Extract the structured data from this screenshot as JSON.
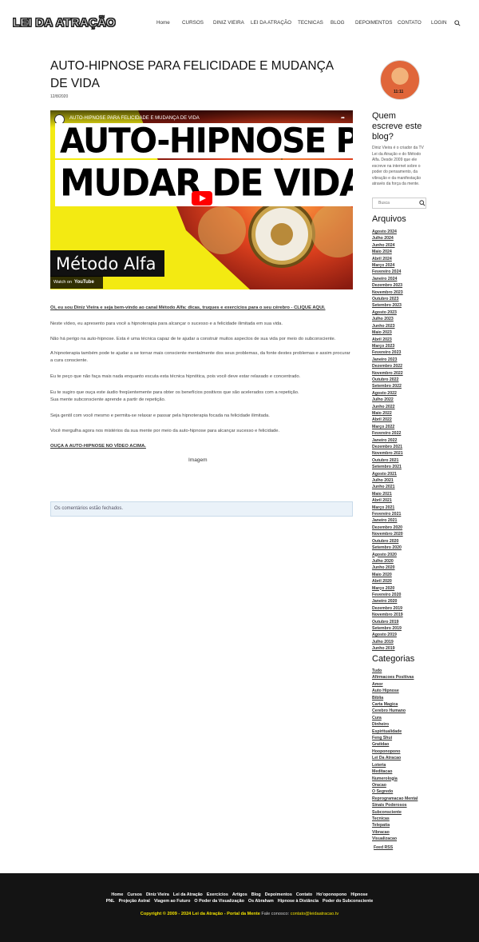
{
  "header": {
    "logo": "LEI DA ATRAÇÃO",
    "nav": [
      "Home",
      "CURSOS",
      "DINIZ VIEIRA",
      "LEI DA ATRAÇÃO",
      "TECNICAS",
      "BLOG",
      "DEPOIMENTOS",
      "CONTATO",
      "LOGIN"
    ]
  },
  "post": {
    "title": "AUTO-HIPNOSE PARA FELICIDADE E MUDANÇA DE VIDA",
    "date": "12/8/2020",
    "video": {
      "channel_title": "AUTO-HIPNOSE PARA FELICIDADE E MUDANÇA DE VIDA",
      "share": "Share",
      "thumb_line1": "AUTO-HIPNOSE PARA",
      "thumb_line2": "MUDAR DE VIDA",
      "brand": "Método Alfa",
      "watch_on": "Watch on",
      "youtube": "YouTube"
    },
    "paragraphs": [
      "Oi, eu sou Diniz Vieira e seja bem-vindo ao canal Método Alfa: dicas, truques e exercícios para o seu cérebro - CLIQUE AQUI.",
      "Neste vídeo, eu apresento para você a hipnoterapia para alcançar o sucesso e a felicidade ilimitada em sua vida.",
      "Não há perigo na auto-hipnose. Esta é uma técnica capaz de te ajudar a construir muitos aspectos de sua vida por meio do subconsciente.",
      "A hipnoterapia também pode te ajudar a se tornar mais consciente mentalmente dos seus problemas, da fonte destes problemas e assim procurar a cura consciente.",
      "Eu te peço que não faça mais nada enquanto escuta esta técnica hipnótica, pois você deve estar relaxado e concentrado.",
      "Eu te sugiro que ouça este áudio freqüentemente para obter os benefícios positivos que são acelerados com a repetição.",
      "Sua mente subconsciente aprende a partir de repetição.",
      "Seja gentil com você mesmo e permita-se relaxar e passar pela hipnoterapia focada na felicidade ilimitada.",
      "Você mergulha agora nos mistérios da sua mente por meio da auto-hipnose para alcançar sucesso e felicidade.",
      "OUÇA A AUTO-HIPNOSE NO VÍDEO ACIMA."
    ],
    "image_alt": "Imagem",
    "comments_closed": "Os comentários estão fechados."
  },
  "sidebar": {
    "about_heading": "Quem escreve este blog?",
    "about_text": "Diniz Vieira é o criador da TV Lei da Atração e do Método Alfa. Desde 2009 que ele escreve na internet sobre o poder do pensamento, da vibração e da manifestação através da força da mente.",
    "search_placeholder": "Busca",
    "archives_heading": "Arquivos",
    "archives": [
      "Agosto 2024",
      "Julho 2024",
      "Junho 2024",
      "Maio 2024",
      "Abril 2024",
      "Março 2024",
      "Fevereiro 2024",
      "Janeiro 2024",
      "Dezembro 2023",
      "Novembro 2023",
      "Outubro 2023",
      "Setembro 2023",
      "Agosto 2023",
      "Julho 2023",
      "Junho 2023",
      "Maio 2023",
      "Abril 2023",
      "Março 2023",
      "Fevereiro 2023",
      "Janeiro 2023",
      "Dezembro 2022",
      "Novembro 2022",
      "Outubro 2022",
      "Setembro 2022",
      "Agosto 2022",
      "Julho 2022",
      "Junho 2022",
      "Maio 2022",
      "Abril 2022",
      "Março 2022",
      "Fevereiro 2022",
      "Janeiro 2022",
      "Dezembro 2021",
      "Novembro 2021",
      "Outubro 2021",
      "Setembro 2021",
      "Agosto 2021",
      "Julho 2021",
      "Junho 2021",
      "Maio 2021",
      "Abril 2021",
      "Março 2021",
      "Fevereiro 2021",
      "Janeiro 2021",
      "Dezembro 2020",
      "Novembro 2020",
      "Outubro 2020",
      "Setembro 2020",
      "Agosto 2020",
      "Julho 2020",
      "Junho 2020",
      "Maio 2020",
      "Abril 2020",
      "Março 2020",
      "Fevereiro 2020",
      "Janeiro 2020",
      "Dezembro 2019",
      "Novembro 2019",
      "Outubro 2019",
      "Setembro 2019",
      "Agosto 2019",
      "Julho 2019",
      "Junho 2019"
    ],
    "categories_heading": "Categorias",
    "categories": [
      "Tudo",
      "Afirmacoes Positivas",
      "Amor",
      "Auto Hipnose",
      "Biblia",
      "Carta Magica",
      "Cerebro Humano",
      "Cura",
      "Dinheiro",
      "Espiritualidade",
      "Feng Shui",
      "Gratidao",
      "Hooponopono",
      "Lei Da Atracao",
      "Loteria",
      "Meditacao",
      "Numerologia",
      "Oracao",
      "O Segredo",
      "Reprogramacao Mental",
      "Sinais Poderosos",
      "Subconsciente",
      "Tecnicas",
      "Telepatia",
      "Vibracao",
      "Visualizacao"
    ],
    "feed_rss": "Feed RSS"
  },
  "footer": {
    "row1": [
      "Home",
      "Cursos",
      "Diniz Vieira",
      "Lei da Atração",
      "Exercícios",
      "Artigos",
      "Blog",
      "Depoimentos",
      "Contato",
      "Ho'oponopono",
      "Hipnose"
    ],
    "row2": [
      "PNL",
      "Projeção Astral",
      "Viagem ao Futuro",
      "O Poder da Visualização",
      "Os Abraham",
      "Hipnose à Distância",
      "Poder do Subconsciente"
    ],
    "copyright": "Copyright © 2009 - 2024 Lei da Atração - Portal da Mente",
    "contact_label": "Fale conosco:",
    "contact_email": "contato@leidaatracao.tv"
  },
  "colors": {
    "footer_bg": "#141414",
    "footer_accent": "#f0e000",
    "comments_bg": "#eaf2f9"
  }
}
